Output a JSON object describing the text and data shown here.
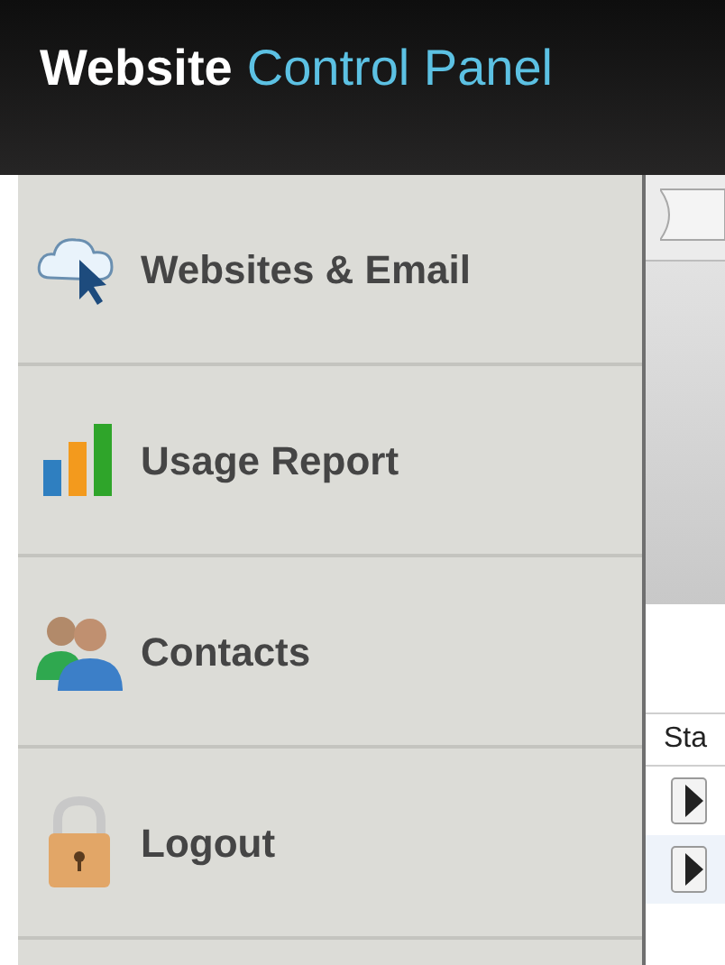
{
  "header": {
    "title_bold": "Website",
    "title_rest": "Control Panel"
  },
  "menu": [
    {
      "label": "Websites & Email",
      "kind": "cloud"
    },
    {
      "label": "Usage Report",
      "kind": "chart"
    },
    {
      "label": "Contacts",
      "kind": "people"
    },
    {
      "label": "Logout",
      "kind": "lock"
    }
  ],
  "panel": {
    "column_1": "Sta",
    "rows": [
      {
        "kind": "play"
      },
      {
        "kind": "play"
      }
    ]
  }
}
